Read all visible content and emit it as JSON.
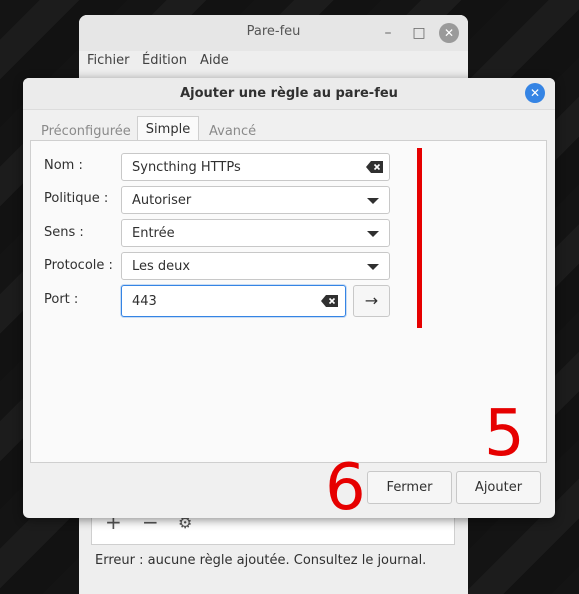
{
  "main_window": {
    "title": "Pare-feu",
    "menu": [
      "Fichier",
      "Édition",
      "Aide"
    ],
    "status": "Erreur : aucune règle ajoutée. Consultez le journal.",
    "toolbar_icons": [
      "plus-icon",
      "minus-icon",
      "gear-icon"
    ]
  },
  "dialog": {
    "title": "Ajouter une règle au pare-feu",
    "tabs": [
      "Préconfigurée",
      "Simple",
      "Avancé"
    ],
    "active_tab": "Simple",
    "fields": {
      "name_label": "Nom :",
      "name_value": "Syncthing HTTPs",
      "policy_label": "Politique :",
      "policy_value": "Autoriser",
      "direction_label": "Sens :",
      "direction_value": "Entrée",
      "protocol_label": "Protocole :",
      "protocol_value": "Les deux",
      "port_label": "Port :",
      "port_value": "443"
    },
    "buttons": {
      "close": "Fermer",
      "add": "Ajouter"
    }
  },
  "annotations": {
    "number_a": "5",
    "number_b": "6",
    "color": "#e60000"
  },
  "colors": {
    "accent": "#3584e4"
  }
}
